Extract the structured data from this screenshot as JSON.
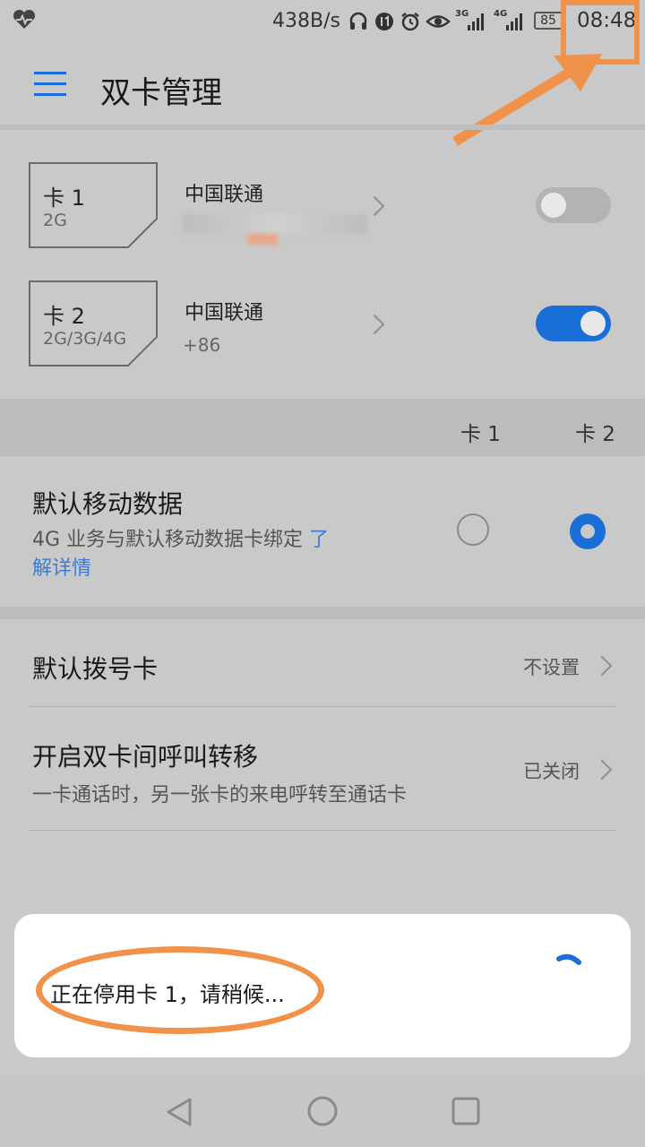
{
  "status_bar": {
    "net_speed": "438B/s",
    "net_3g": "3G",
    "net_4g": "4G",
    "battery": "85",
    "time": "08:48"
  },
  "app_bar": {
    "title": "双卡管理"
  },
  "cards": [
    {
      "label": "卡 1",
      "type": "2G",
      "carrier": "中国联通",
      "number": "",
      "enabled": false
    },
    {
      "label": "卡 2",
      "type": "2G/3G/4G",
      "carrier": "中国联通",
      "number": "+86",
      "enabled": true
    }
  ],
  "column_headers": {
    "card1": "卡 1",
    "card2": "卡 2"
  },
  "default_data": {
    "title": "默认移动数据",
    "desc_line1": "4G 业务与默认移动数据卡绑定",
    "link_part1": "了",
    "link_part2": "解详情",
    "selected": "card2"
  },
  "default_dial": {
    "title": "默认拨号卡",
    "value": "不设置"
  },
  "call_forward": {
    "title": "开启双卡间呼叫转移",
    "desc": "一卡通话时，另一张卡的来电呼转至通话卡",
    "value": "已关闭"
  },
  "dialog": {
    "message": "正在停用卡 1，请稍候..."
  },
  "colors": {
    "accent": "#1a6fd6",
    "annotation": "#f0924a"
  }
}
